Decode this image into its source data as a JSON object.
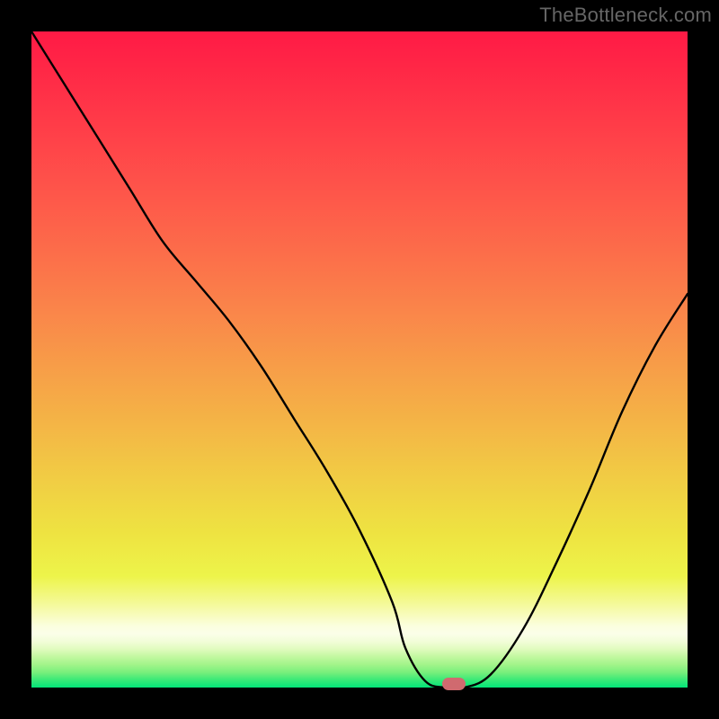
{
  "watermark": "TheBottleneck.com",
  "chart_data": {
    "type": "line",
    "title": "",
    "xlabel": "",
    "ylabel": "",
    "xlim": [
      0,
      100
    ],
    "ylim": [
      0,
      100
    ],
    "x": [
      0,
      5,
      10,
      15,
      20,
      25,
      30,
      35,
      40,
      45,
      50,
      55,
      57,
      60,
      63,
      66,
      70,
      75,
      80,
      85,
      90,
      95,
      100
    ],
    "values": [
      100,
      92,
      84,
      76,
      68,
      62,
      56,
      49,
      41,
      33,
      24,
      13,
      6,
      1,
      0,
      0,
      2,
      9,
      19,
      30,
      42,
      52,
      60
    ],
    "gradient_bands": [
      {
        "offset": 0.0,
        "color": "#FF1A45"
      },
      {
        "offset": 0.085,
        "color": "#FF2E47"
      },
      {
        "offset": 0.17,
        "color": "#FF4349"
      },
      {
        "offset": 0.255,
        "color": "#FE584A"
      },
      {
        "offset": 0.34,
        "color": "#FC6E4A"
      },
      {
        "offset": 0.425,
        "color": "#FA854A"
      },
      {
        "offset": 0.51,
        "color": "#F79D48"
      },
      {
        "offset": 0.595,
        "color": "#F4B446"
      },
      {
        "offset": 0.68,
        "color": "#F1CC44"
      },
      {
        "offset": 0.765,
        "color": "#EEE341"
      },
      {
        "offset": 0.83,
        "color": "#EDF44A"
      },
      {
        "offset": 0.87,
        "color": "#F4F994"
      },
      {
        "offset": 0.906,
        "color": "#FBFEDE"
      },
      {
        "offset": 0.918,
        "color": "#FBFEE9"
      },
      {
        "offset": 0.93,
        "color": "#F2FDD8"
      },
      {
        "offset": 0.942,
        "color": "#DFFBBD"
      },
      {
        "offset": 0.953,
        "color": "#C2F8A0"
      },
      {
        "offset": 0.965,
        "color": "#A2F48A"
      },
      {
        "offset": 0.977,
        "color": "#78EF7C"
      },
      {
        "offset": 0.988,
        "color": "#3BE977"
      },
      {
        "offset": 1.0,
        "color": "#02E478"
      }
    ],
    "marker": {
      "x": 64.4,
      "y": 0.5,
      "color": "#D06A6F"
    }
  }
}
